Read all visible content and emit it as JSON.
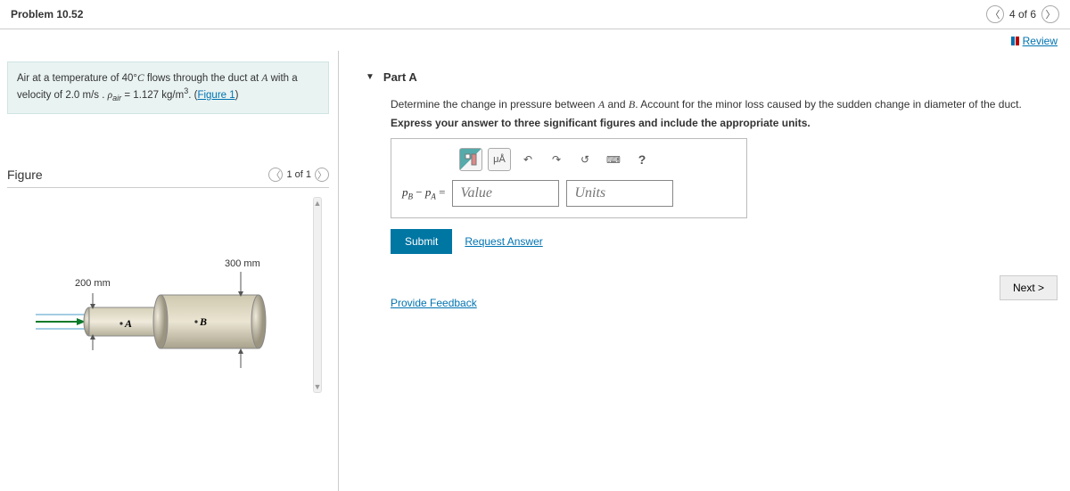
{
  "header": {
    "title": "Problem 10.52",
    "nav_count": "4 of 6"
  },
  "review": {
    "label": "Review"
  },
  "intro": {
    "pre": "Air at a temperature of 40°",
    "c_sym": "C",
    "mid1": " flows through the duct at ",
    "a_sym": "A",
    "mid2": " with a velocity of 2.0 ",
    "units1": "m/s",
    "dot": " . ",
    "rho": "ρ",
    "rho_sub": "air",
    "eq": " = 1.127 ",
    "units2": "kg/m",
    "cube": "3",
    "tail": ". (",
    "fig_link": "Figure 1",
    "close": ")"
  },
  "figure": {
    "label": "Figure",
    "nav": "1 of 1",
    "dim_small": "200 mm",
    "dim_large": "300 mm",
    "ptA": "A",
    "ptB": "B"
  },
  "part": {
    "label": "Part A",
    "prompt_pre": "Determine the change in pressure between ",
    "prompt_a": "A",
    "prompt_mid": " and ",
    "prompt_b": "B",
    "prompt_tail": ". Account for the minor loss caused by the sudden change in diameter of the duct.",
    "hint": "Express your answer to three significant figures and include the appropriate units.",
    "tools": {
      "mu": "μÅ",
      "undo": "↶",
      "redo": "↷",
      "reset": "↺",
      "kbd": "⌨",
      "help": "?"
    },
    "lhs_pb": "p",
    "lhs_b": "B",
    "lhs_minus": " − ",
    "lhs_pa": "p",
    "lhs_a": "A",
    "lhs_eq": " =",
    "value_ph": "Value",
    "units_ph": "Units",
    "submit": "Submit",
    "request": "Request Answer"
  },
  "feedback": "Provide Feedback",
  "next": "Next >"
}
